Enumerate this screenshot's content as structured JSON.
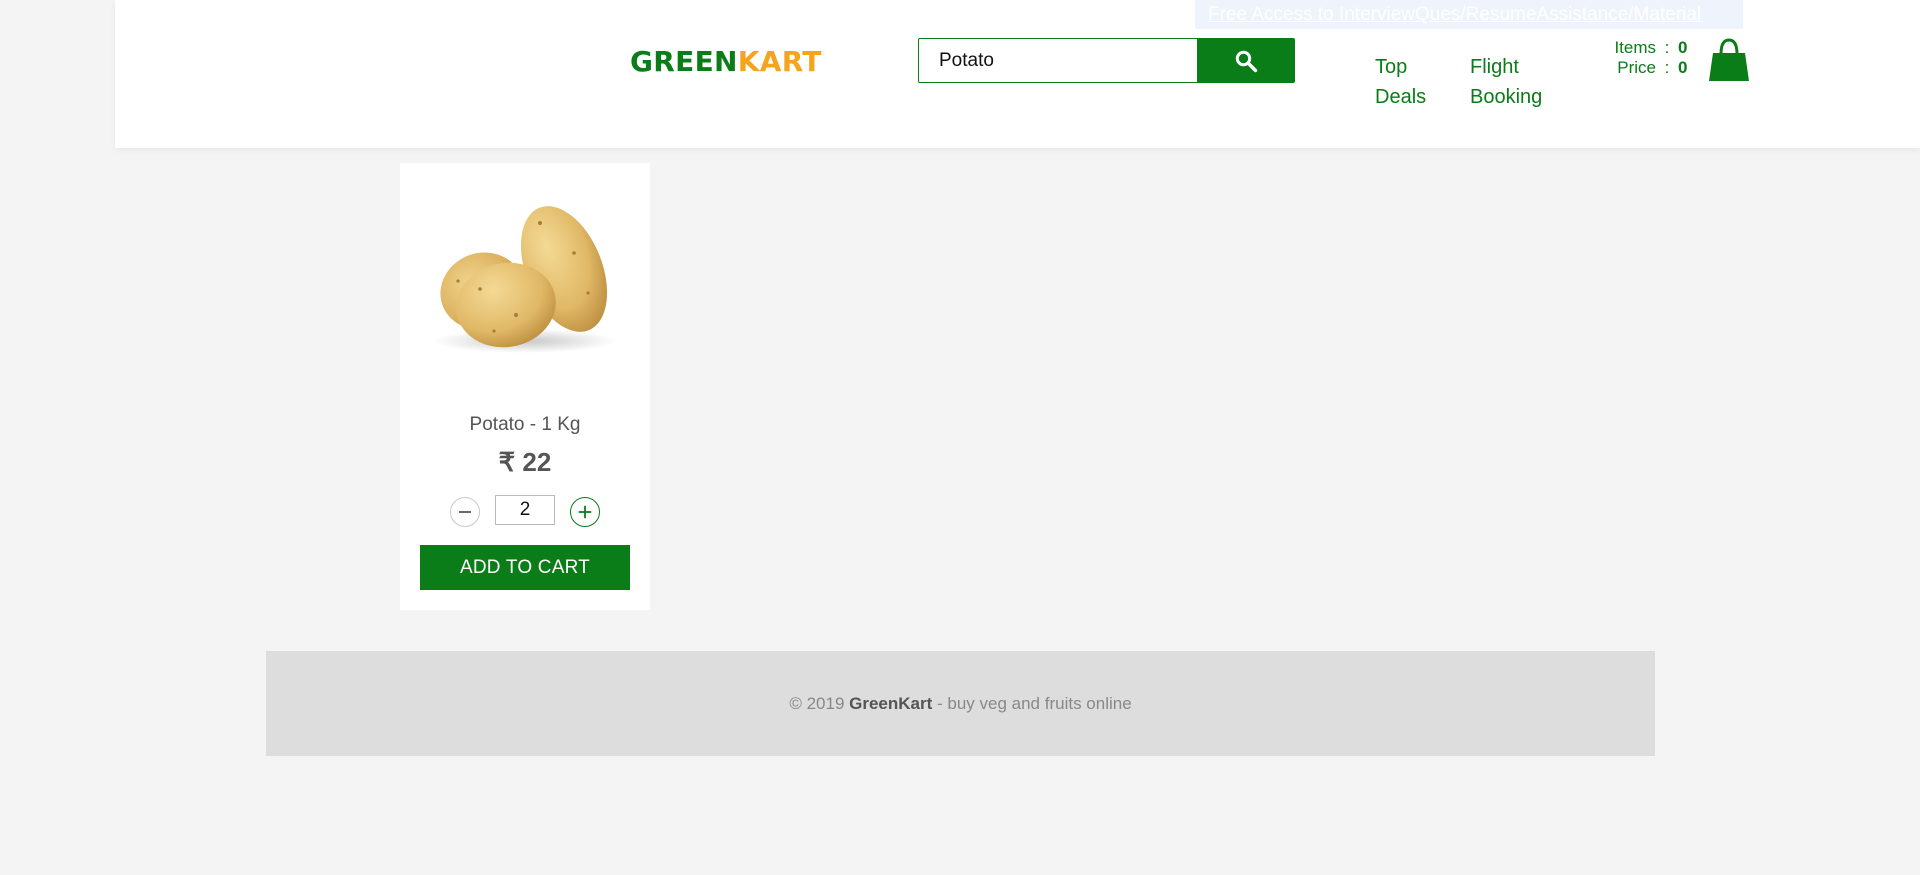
{
  "header": {
    "promo_link": "Free Access to InterviewQues/ResumeAssistance/Material",
    "logo": {
      "part1": "GREEN",
      "part2": "KART"
    },
    "search": {
      "value": "Potato"
    },
    "nav": [
      {
        "line1": "Top",
        "line2": "Deals"
      },
      {
        "line1": "Flight",
        "line2": "Booking"
      }
    ],
    "cart": {
      "items_label": "Items",
      "items_value": "0",
      "price_label": "Price",
      "price_value": "0",
      "separator": ":"
    }
  },
  "products": [
    {
      "name": "Potato - 1 Kg",
      "price": "₹ 22",
      "quantity": "2",
      "add_label": "ADD TO CART",
      "image_icon": "potato-image"
    }
  ],
  "footer": {
    "prefix": "© 2019 ",
    "brand": "GreenKart",
    "suffix": " - buy veg and fruits online"
  },
  "colors": {
    "brand_green": "#0a7c18",
    "brand_orange": "#f7a41d",
    "background": "#f4f4f4",
    "footer_bg": "#dddddd"
  },
  "icons": [
    "search-icon",
    "cart-bag-icon",
    "minus-icon",
    "plus-icon"
  ]
}
